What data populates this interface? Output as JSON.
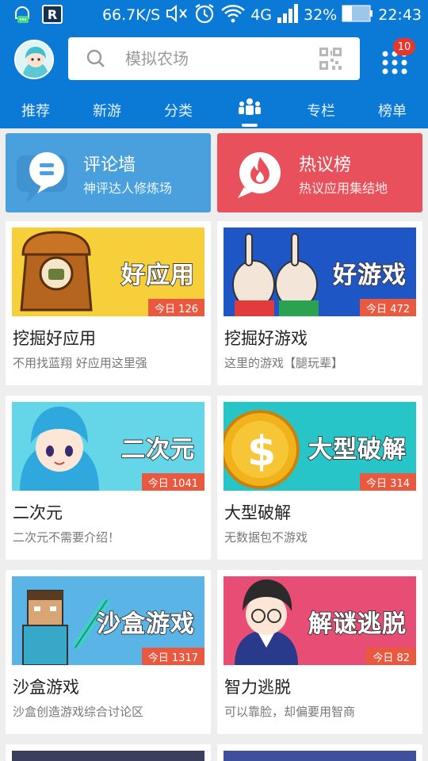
{
  "status_bar": {
    "speed": "66.7K/S",
    "network": "4G",
    "battery": "32%",
    "time": "22:43",
    "icons": [
      "notification-icon",
      "r-app-icon",
      "mute-icon",
      "alarm-icon",
      "wifi-icon",
      "signal-icon",
      "battery-icon"
    ]
  },
  "header": {
    "search_placeholder": "模拟农场",
    "notification_count": "10",
    "icons": [
      "avatar",
      "search-icon",
      "qr-code-icon",
      "apps-grid-icon"
    ]
  },
  "tabs": [
    {
      "label": "推荐"
    },
    {
      "label": "新游"
    },
    {
      "label": "分类"
    },
    {
      "label": "",
      "icon": "community-icon",
      "active": true
    },
    {
      "label": "专栏"
    },
    {
      "label": "榜单"
    }
  ],
  "banners": [
    {
      "title": "评论墙",
      "subtitle": "神评达人修炼场",
      "color": "#4aa0dd",
      "icon": "comment-bubble-icon"
    },
    {
      "title": "热议榜",
      "subtitle": "热议应用集结地",
      "color": "#e8515b",
      "icon": "flame-icon"
    }
  ],
  "cards": [
    {
      "art_text": "好应用",
      "today": "今日 126",
      "title": "挖掘好应用",
      "desc": "不用找蓝翔 好应用这里强",
      "bg": "#f7cf3b"
    },
    {
      "art_text": "好游戏",
      "today": "今日 472",
      "title": "挖掘好游戏",
      "desc": "这里的游戏【腿玩辈】",
      "bg": "#1f56c6"
    },
    {
      "art_text": "二次元",
      "today": "今日 1041",
      "title": "二次元",
      "desc": "二次元不需要介绍！",
      "bg": "#64d6e8"
    },
    {
      "art_text": "大型破解",
      "today": "今日 314",
      "title": "大型破解",
      "desc": "无数据包不游戏",
      "bg": "#27c5c8"
    },
    {
      "art_text": "沙盒游戏",
      "today": "今日 1317",
      "title": "沙盒游戏",
      "desc": "沙盒创造游戏综合讨论区",
      "bg": "#5ab4e6"
    },
    {
      "art_text": "解谜逃脱",
      "today": "今日 82",
      "title": "智力逃脱",
      "desc": "可以靠脸，却偏要用智商",
      "bg": "#e84d76"
    }
  ]
}
